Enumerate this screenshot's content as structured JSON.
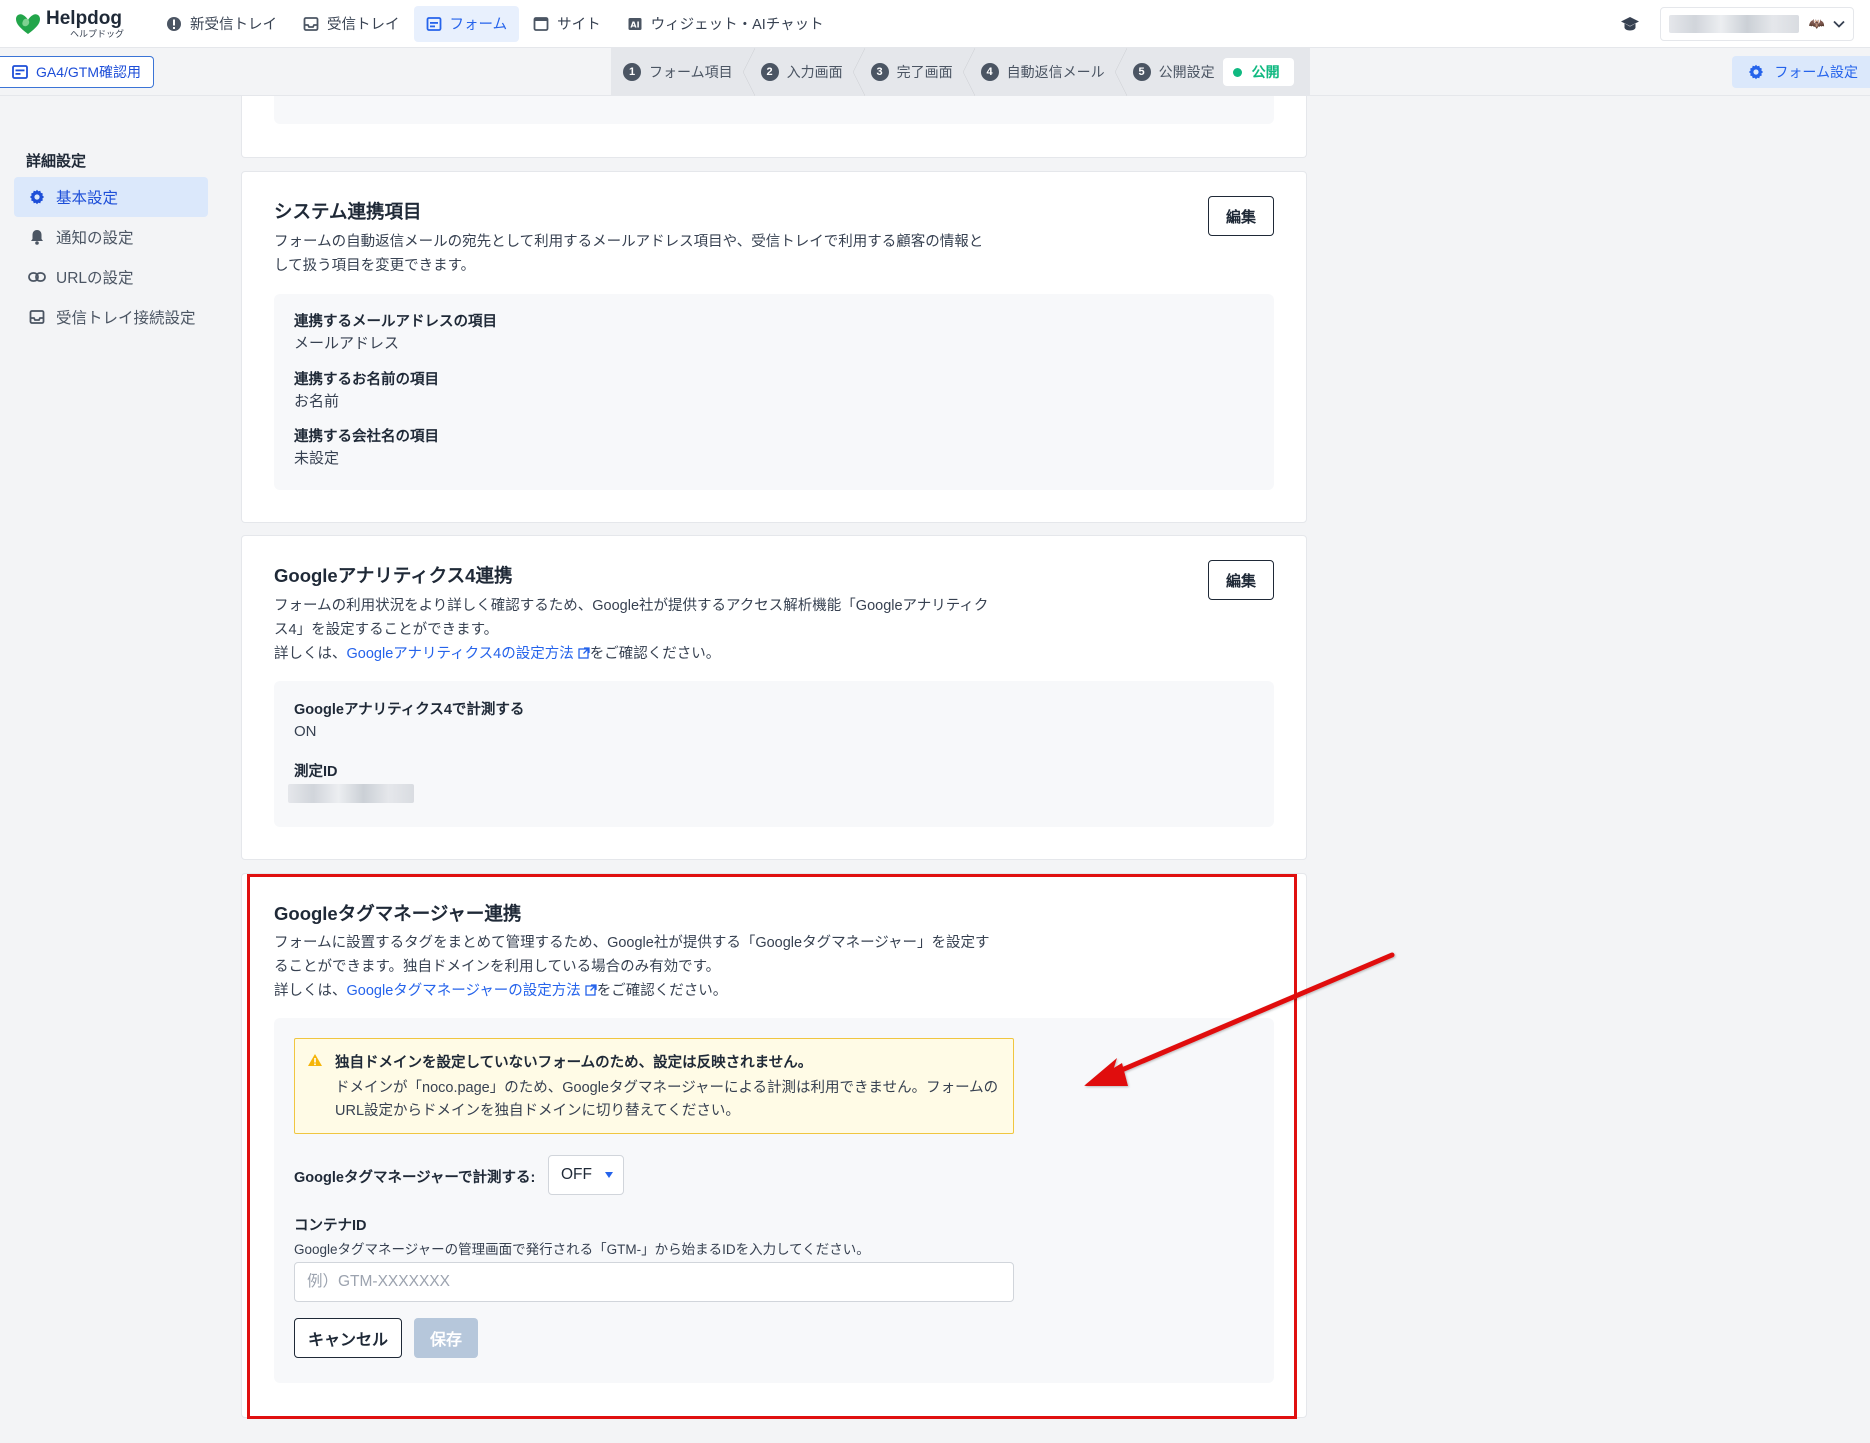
{
  "header": {
    "logo": {
      "name": "Helpdog",
      "sub": "ヘルプドッグ"
    },
    "nav": [
      {
        "label": "新受信トレイ",
        "icon": "new-inbox-icon",
        "active": false
      },
      {
        "label": "受信トレイ",
        "icon": "inbox-icon",
        "active": false
      },
      {
        "label": "フォーム",
        "icon": "form-icon",
        "active": true
      },
      {
        "label": "サイト",
        "icon": "site-icon",
        "active": false
      },
      {
        "label": "ウィジェット・AIチャット",
        "icon": "ai-icon",
        "active": false
      }
    ],
    "account_glyph": "🦇"
  },
  "subbar": {
    "form_name": "GA4/GTM確認用",
    "steps": [
      {
        "num": "1",
        "label": "フォーム項目"
      },
      {
        "num": "2",
        "label": "入力画面"
      },
      {
        "num": "3",
        "label": "完了画面"
      },
      {
        "num": "4",
        "label": "自動返信メール"
      },
      {
        "num": "5",
        "label": "公開設定"
      }
    ],
    "status": "公開",
    "settings_label": "フォーム設定"
  },
  "sidebar": {
    "title": "詳細設定",
    "items": [
      {
        "label": "基本設定",
        "icon": "gear-icon",
        "active": true
      },
      {
        "label": "通知の設定",
        "icon": "bell-icon",
        "active": false
      },
      {
        "label": "URLの設定",
        "icon": "link-icon",
        "active": false
      },
      {
        "label": "受信トレイ接続設定",
        "icon": "inbox-icon",
        "active": false
      }
    ]
  },
  "system_card": {
    "title": "システム連携項目",
    "edit_label": "編集",
    "desc": "フォームの自動返信メールの宛先として利用するメールアドレス項目や、受信トレイで利用する顧客の情報として扱う項目を変更できます。",
    "fields": [
      {
        "label": "連携するメールアドレスの項目",
        "value": "メールアドレス"
      },
      {
        "label": "連携するお名前の項目",
        "value": "お名前"
      },
      {
        "label": "連携する会社名の項目",
        "value": "未設定"
      }
    ]
  },
  "ga4_card": {
    "title": "Googleアナリティクス4連携",
    "edit_label": "編集",
    "desc": "フォームの利用状況をより詳しく確認するため、Google社が提供するアクセス解析機能「Googleアナリティクス4」を設定することができます。",
    "more_prefix": "詳しくは、",
    "more_link": "Googleアナリティクス4の設定方法",
    "more_suffix": "をご確認ください。",
    "measure_label": "Googleアナリティクス4で計測する",
    "measure_value": "ON",
    "id_label": "測定ID"
  },
  "gtm_card": {
    "title": "Googleタグマネージャー連携",
    "desc": "フォームに設置するタグをまとめて管理するため、Google社が提供する「Googleタグマネージャー」を設定することができます。独自ドメインを利用している場合のみ有効です。",
    "more_prefix": "詳しくは、",
    "more_link": "Googleタグマネージャーの設定方法",
    "more_suffix": "をご確認ください。",
    "warning_title": "独自ドメインを設定していないフォームのため、設定は反映されません。",
    "warning_body": "ドメインが「noco.page」のため、Googleタグマネージャーによる計測は利用できません。フォームのURL設定からドメインを独自ドメインに切り替えてください。",
    "measure_label": "Googleタグマネージャーで計測する:",
    "measure_value": "OFF",
    "container_label": "コンテナID",
    "container_help": "Googleタグマネージャーの管理画面で発行される「GTM-」から始まるIDを入力してください。",
    "container_placeholder": "例）GTM-XXXXXXX",
    "cancel_label": "キャンセル",
    "save_label": "保存"
  },
  "colors": {
    "accent": "#2563eb",
    "success": "#10b981",
    "annotation": "#e01010",
    "warning_bg": "#fffbe6"
  }
}
